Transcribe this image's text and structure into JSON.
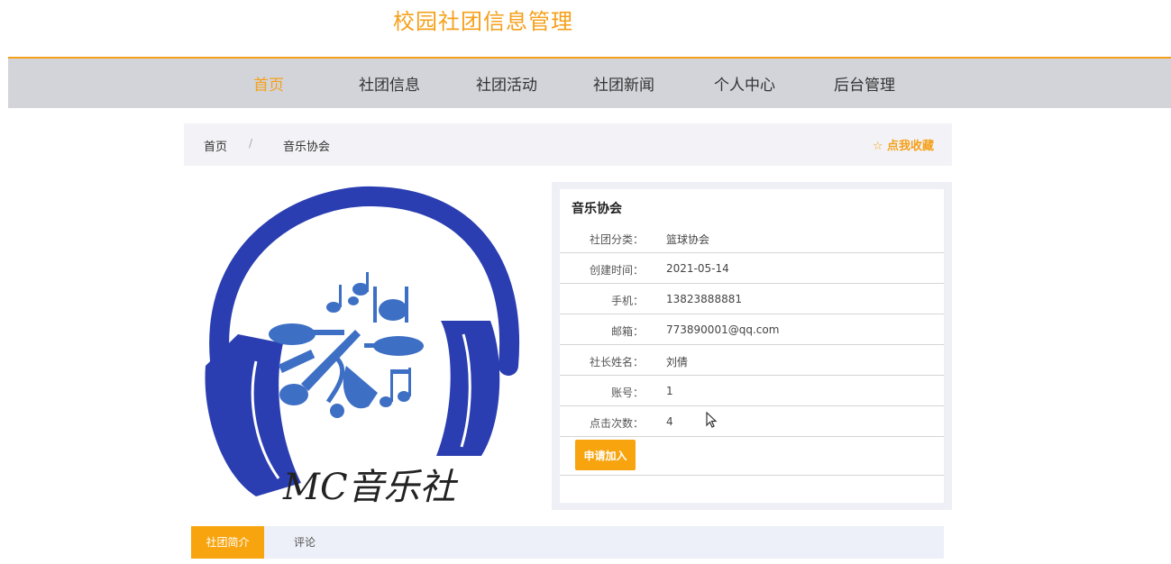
{
  "site": {
    "title": "校园社团信息管理"
  },
  "nav": {
    "items": [
      {
        "label": "首页"
      },
      {
        "label": "社团信息"
      },
      {
        "label": "社团活动"
      },
      {
        "label": "社团新闻"
      },
      {
        "label": "个人中心"
      },
      {
        "label": "后台管理"
      }
    ],
    "active_index": 0
  },
  "breadcrumb": {
    "home": "首页",
    "separator": "/",
    "current": "音乐协会"
  },
  "favorite": {
    "label": "☆ 点我收藏"
  },
  "logo": {
    "text": "MC音乐社",
    "icon": "headphones-music-icon"
  },
  "club": {
    "name": "音乐协会",
    "fields": [
      {
        "label": "社团分类：",
        "value": "篮球协会"
      },
      {
        "label": "创建时间：",
        "value": "2021-05-14"
      },
      {
        "label": "手机：",
        "value": "13823888881"
      },
      {
        "label": "邮箱：",
        "value": "773890001@qq.com"
      },
      {
        "label": "社长姓名：",
        "value": "刘倩"
      },
      {
        "label": "账号：",
        "value": "1"
      },
      {
        "label": "点击次数：",
        "value": "4"
      }
    ],
    "join_label": "申请加入"
  },
  "tabs": [
    {
      "label": "社团简介"
    },
    {
      "label": "评论"
    }
  ],
  "colors": {
    "accent": "#f5a01a",
    "nav_bg": "#d3d4da",
    "logo_blue": "#2a3eb1"
  }
}
